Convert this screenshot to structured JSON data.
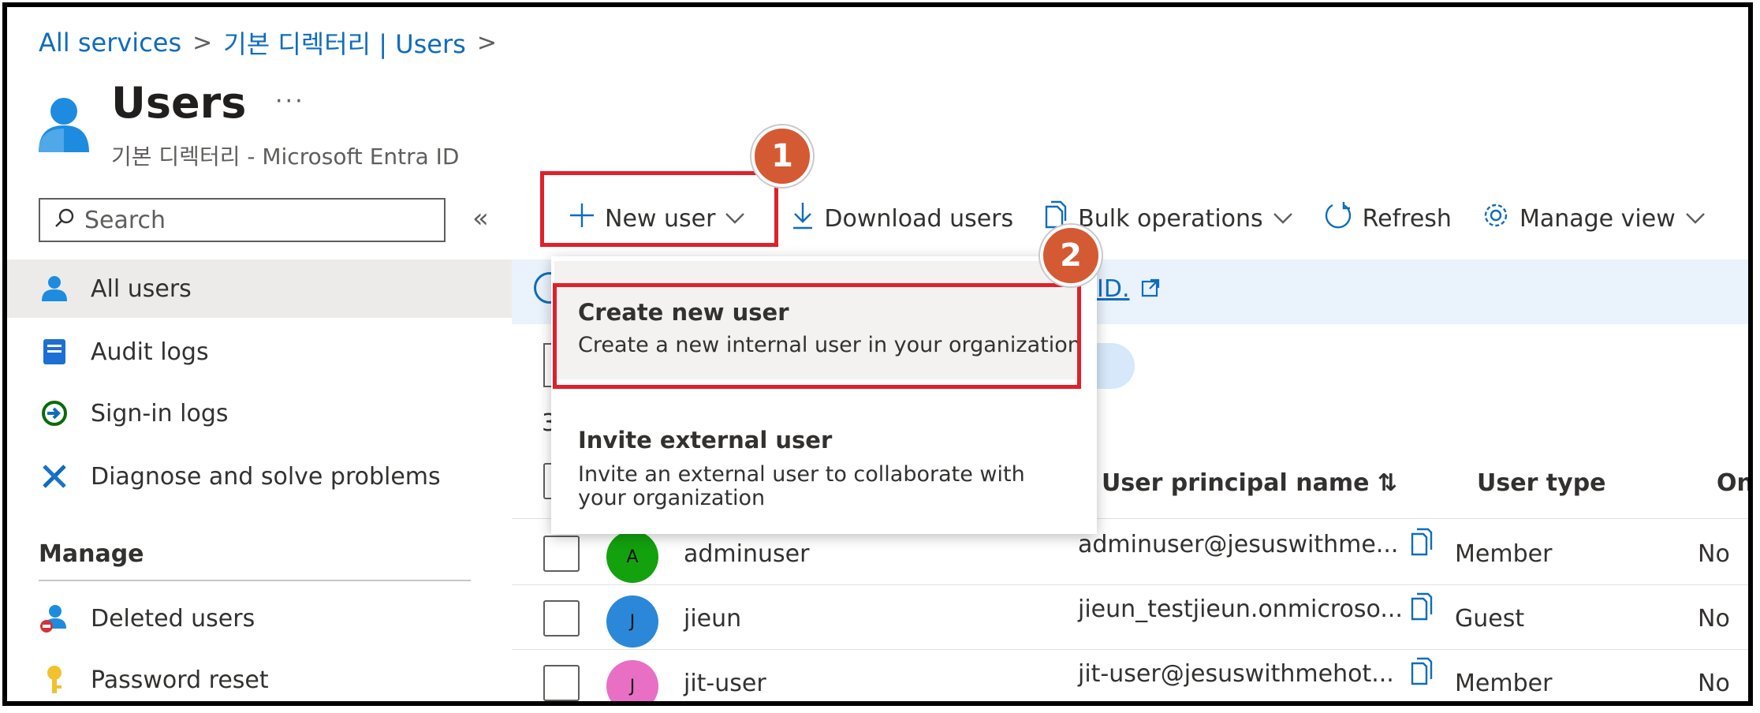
{
  "breadcrumb": {
    "items": [
      "All services",
      "기본 디렉터리 | Users"
    ],
    "separator": ">"
  },
  "header": {
    "title": "Users",
    "more": "···",
    "subtitle": "기본 디렉터리 - Microsoft Entra ID"
  },
  "sidebar": {
    "search_placeholder": "Search",
    "collapse": "«",
    "items": [
      {
        "label": "All users",
        "icon": "user-icon",
        "selected": true
      },
      {
        "label": "Audit logs",
        "icon": "audit-log-icon"
      },
      {
        "label": "Sign-in logs",
        "icon": "sign-in-icon"
      },
      {
        "label": "Diagnose and solve problems",
        "icon": "wrench-icon"
      }
    ],
    "manage_heading": "Manage",
    "manage_items": [
      {
        "label": "Deleted users",
        "icon": "deleted-user-icon"
      },
      {
        "label": "Password reset",
        "icon": "key-icon"
      }
    ]
  },
  "toolbar": {
    "new_user": "New user",
    "download_users": "Download users",
    "bulk_operations": "Bulk operations",
    "refresh": "Refresh",
    "manage_view": "Manage view"
  },
  "callouts": {
    "step1": "1",
    "step2": "2"
  },
  "info_bar": {
    "link_text": "ID."
  },
  "count_fragment": "3",
  "dropdown": {
    "options": [
      {
        "title": "Create new user",
        "description": "Create a new internal user in your organization"
      },
      {
        "title": "Invite external user",
        "description": "Invite an external user to collaborate with your organization"
      }
    ]
  },
  "table": {
    "columns": [
      "User principal name ⇅",
      "User type",
      "On-"
    ],
    "rows": [
      {
        "initial": "A",
        "name": "adminuser",
        "upn": "adminuser@jesuswithme...",
        "type": "Member",
        "onprem": "No",
        "avatar_color": "#13a10e"
      },
      {
        "initial": "J",
        "name": "jieun",
        "upn": "jieun_testjieun.onmicroso...",
        "type": "Guest",
        "onprem": "No",
        "avatar_color": "#2b88d8"
      },
      {
        "initial": "J",
        "name": "jit-user",
        "upn": "jit-user@jesuswithmehot...",
        "type": "Member",
        "onprem": "No",
        "avatar_color": "#e86fc4"
      }
    ]
  },
  "colors": {
    "accent": "#0f6cbd",
    "highlight": "#e0202a",
    "badge": "#d45a34"
  }
}
